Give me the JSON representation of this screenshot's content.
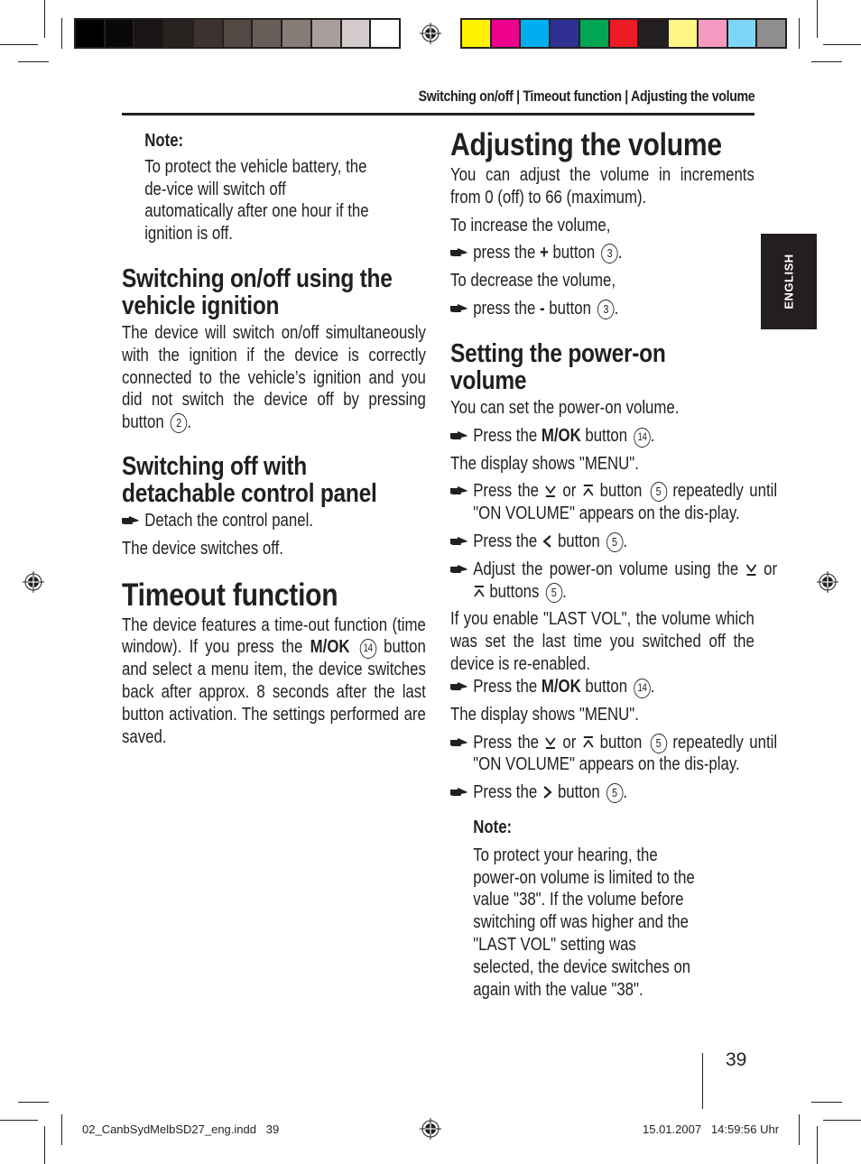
{
  "print_marks": {
    "gray_swatches": [
      "#000000",
      "#0b0908",
      "#181514",
      "#262220",
      "#3c3330",
      "#524945",
      "#675e59",
      "#857c77",
      "#a89f9c",
      "#d4cccc",
      "#ffffff"
    ],
    "color_swatches": [
      "#fff200",
      "#ec008c",
      "#00aeef",
      "#2e3192",
      "#00a651",
      "#ed1c24",
      "#231f20",
      "#fff685",
      "#f49ac1",
      "#7dd5f7",
      "#8f8d8e"
    ],
    "slug_file": "02_CanbSydMelbSD27_eng.indd   39",
    "slug_date": "15.01.2007   14:59:56 Uhr"
  },
  "header": {
    "running_head": "Switching on/off | Timeout function | Adjusting the volume"
  },
  "language_tab": "ENGLISH",
  "page_number": "39",
  "left": {
    "note_label": "Note:",
    "note_text": "To protect the vehicle battery, the de-vice will switch off automatically after one hour if the ignition is off.",
    "ignition_heading": "Switching on/off using the vehicle ignition",
    "ignition_text": "The device will switch on/off simultaneously with the ignition if the device is correctly connected to the vehicle’s ignition and you did not switch the device off by pressing button",
    "ignition_button": "2",
    "detach_heading": "Switching off with detachable control panel",
    "detach_step": "Detach the control panel.",
    "detach_result": "The device switches off.",
    "timeout_heading": "Timeout function",
    "timeout_text_1": "The device features a time-out function (time window). If you press the",
    "timeout_bold": "M/OK",
    "timeout_button": "14",
    "timeout_text_2": "button and select a menu item, the device switches back after approx. 8 seconds after the last button activation. The settings performed are saved."
  },
  "right": {
    "volume_heading": "Adjusting the volume",
    "volume_intro": "You can adjust the volume in increments from 0 (off) to 66 (maximum).",
    "increase_label": "To increase the volume,",
    "increase_step_pre": "press the",
    "increase_step_key": "+",
    "increase_step_post": "button",
    "increase_button": "3",
    "decrease_label": "To decrease the volume,",
    "decrease_step_pre": "press the",
    "decrease_step_key": "-",
    "decrease_step_post": "button",
    "decrease_button": "3",
    "poweron_heading": "Setting the power-on volume",
    "poweron_intro": "You can set the power-on volume.",
    "steps": {
      "press_the": "Press the",
      "mok": "M/OK",
      "button": "button",
      "or": "or",
      "repeatedly": "repeatedly",
      "until_on_volume": "until \"ON VOLUME\" appears on the dis-play.",
      "adjust_pre": "Adjust the power-on volume using the",
      "buttons": "buttons",
      "btn14": "14",
      "btn5": "5"
    },
    "display_menu": "The display shows \"MENU\".",
    "lastvol_text": "If you enable \"LAST VOL\", the volume which was set the last time you switched off the device is re-enabled.",
    "note_label": "Note:",
    "note_text": "To protect your hearing, the power-on volume is limited to the value \"38\". If the volume before switching off was higher and the \"LAST VOL\" setting was selected, the device switches on again with the value \"38\"."
  }
}
